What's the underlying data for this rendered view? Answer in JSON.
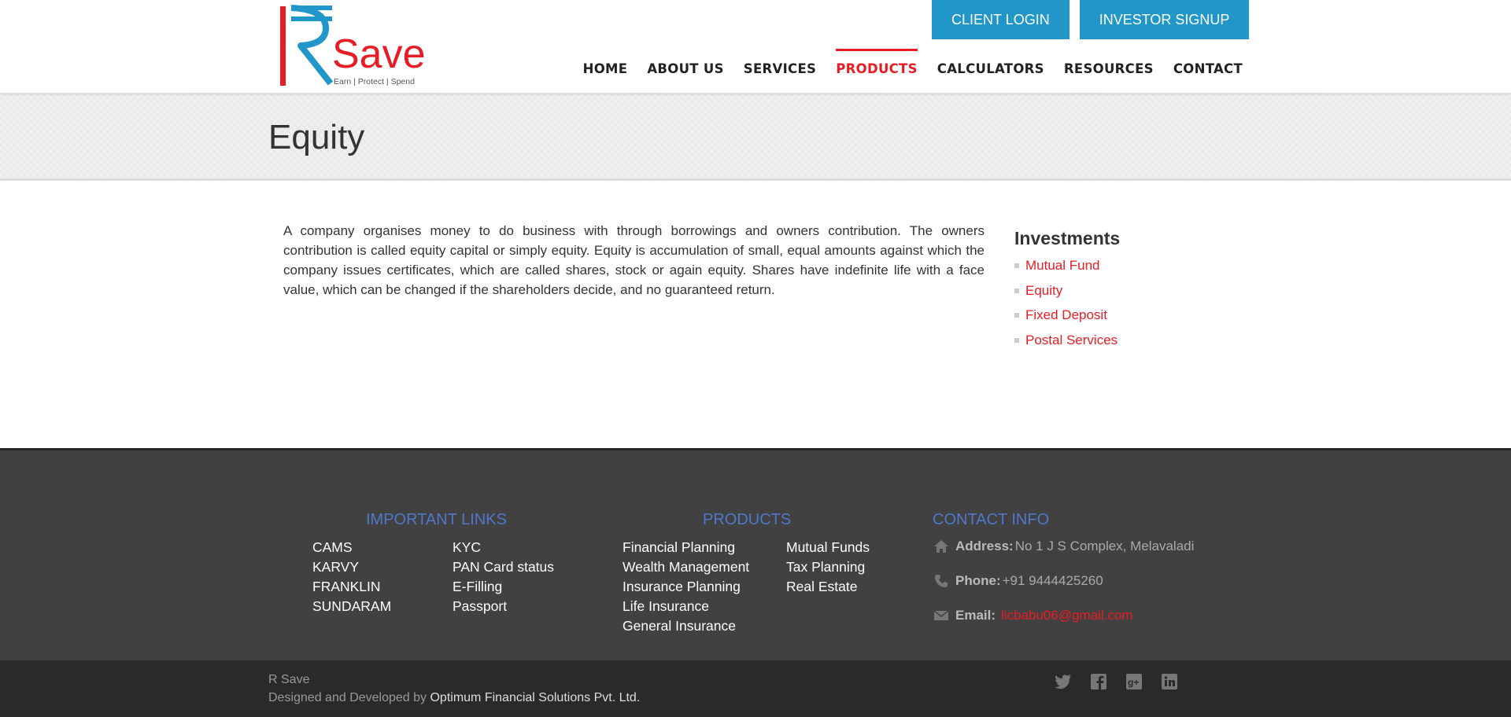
{
  "header": {
    "logo_text": "Save",
    "logo_tagline": "Earn | Protect | Spend",
    "client_login": "CLIENT LOGIN",
    "investor_signup": "INVESTOR SIGNUP",
    "nav": [
      {
        "label": "HOME",
        "active": false
      },
      {
        "label": "ABOUT US",
        "active": false
      },
      {
        "label": "SERVICES",
        "active": false
      },
      {
        "label": "PRODUCTS",
        "active": true
      },
      {
        "label": "CALCULATORS",
        "active": false
      },
      {
        "label": "RESOURCES",
        "active": false
      },
      {
        "label": "CONTACT",
        "active": false
      }
    ]
  },
  "page": {
    "title": "Equity",
    "body": "A company organises money to do business with through borrowings and owners contribution. The owners contribution is called equity capital or simply equity. Equity is accumulation of small, equal amounts against which the company issues certificates, which are called shares, stock or again equity. Shares have indefinite life with a face value, which can be changed if the shareholders decide, and no guaranteed return."
  },
  "sidebar": {
    "title": "Investments",
    "items": [
      "Mutual Fund",
      "Equity",
      "Fixed Deposit",
      "Postal Services"
    ]
  },
  "footer": {
    "important_links_title": "IMPORTANT LINKS",
    "important_links_col1": [
      "CAMS",
      "KARVY",
      "FRANKLIN",
      "SUNDARAM"
    ],
    "important_links_col2": [
      "KYC",
      "PAN Card status",
      "E-Filling",
      "Passport"
    ],
    "products_title": "PRODUCTS",
    "products_col1": [
      "Financial Planning",
      "Wealth Management",
      "Insurance Planning",
      "Life Insurance",
      "General Insurance"
    ],
    "products_col2": [
      "Mutual Funds",
      "Tax Planning",
      "Real Estate"
    ],
    "contact_title": "CONTACT INFO",
    "address_label": "Address:",
    "address_value": "No 1 J S Complex, Melavaladi",
    "phone_label": "Phone:",
    "phone_value": "+91 9444425260",
    "email_label": "Email:",
    "email_value": "licbabu06@gmail.com"
  },
  "bottom": {
    "site_name": "R Save",
    "designed_by": "Designed and Developed by ",
    "company": "Optimum Financial Solutions Pvt. Ltd.",
    "socials": [
      "twitter-icon",
      "facebook-icon",
      "google-plus-icon",
      "linkedin-icon"
    ]
  },
  "colors": {
    "accent_red": "#e81c24",
    "button_blue": "#2196c8",
    "footer_title_blue": "#4f78c9",
    "footer_bg": "#414141",
    "bottom_bar_bg": "#2a2a2a"
  }
}
